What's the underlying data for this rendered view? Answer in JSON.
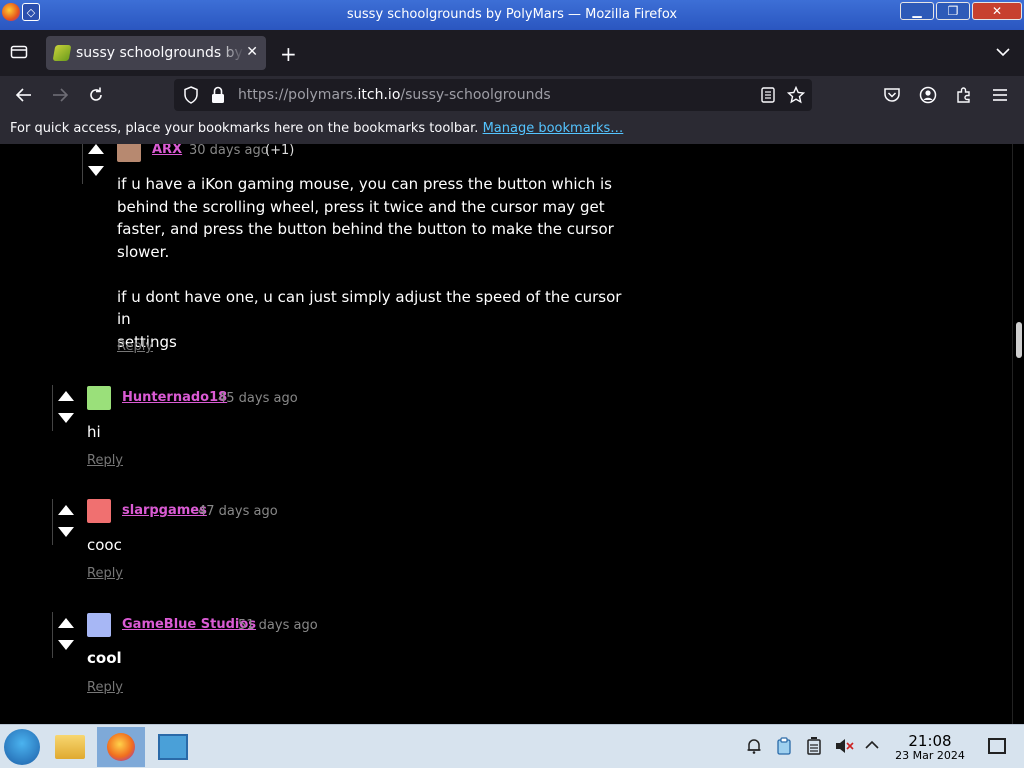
{
  "window": {
    "title": "sussy schoolgrounds by PolyMars — Mozilla Firefox"
  },
  "tab": {
    "label": "sussy schoolgrounds by PolyMars",
    "close": "✕"
  },
  "toolbar": {
    "new_tab": "+"
  },
  "url": {
    "prefix": "https://polymars.",
    "domain": "itch.io",
    "path": "/sussy-schoolgrounds"
  },
  "bookmarks_bar": {
    "text": "For quick access, place your bookmarks here on the bookmarks toolbar.",
    "link": "Manage bookmarks…"
  },
  "comments": [
    {
      "user": "ARX",
      "time": "30 days ago",
      "votes": "(+1)",
      "avatar_color": "#b78970",
      "body": "if u have a iKon gaming mouse, you can press the button which is\nbehind the scrolling wheel, press it twice and the cursor may get\nfaster, and press the button behind the button to make the cursor\nslower.\n\nif u dont have one, u can just simply adjust the speed of the cursor in\nsettings",
      "reply": "Reply"
    },
    {
      "user": "Hunternado18",
      "time": "45 days ago",
      "avatar_color": "#9ae07a",
      "body": "hi",
      "reply": "Reply"
    },
    {
      "user": "slarpgames",
      "time": "47 days ago",
      "avatar_color": "#f07070",
      "body": "cooc",
      "reply": "Reply"
    },
    {
      "user": "GameBlue Studios",
      "time": "51 days ago",
      "avatar_color": "#a7b7f5",
      "body": "cool",
      "reply": "Reply"
    }
  ],
  "clock": {
    "time": "21:08",
    "date": "23 Mar 2024"
  }
}
